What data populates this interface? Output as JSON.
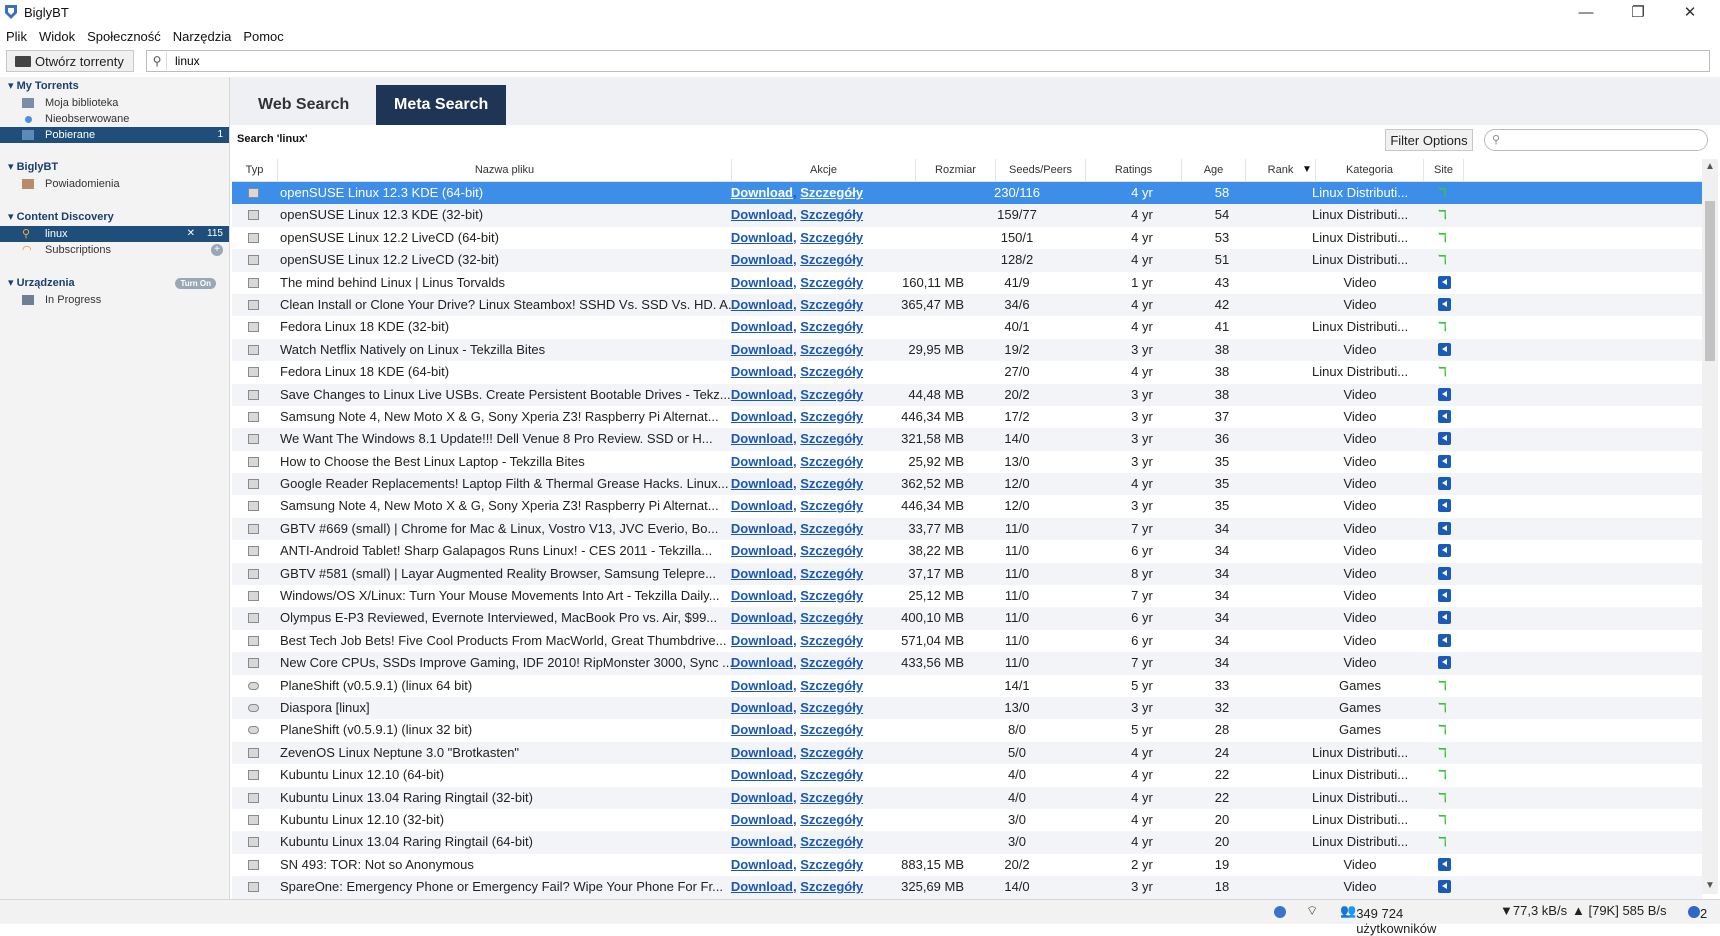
{
  "window": {
    "title": "BiglyBT"
  },
  "menu": [
    "Plik",
    "Widok",
    "Społeczność",
    "Narzędzia",
    "Pomoc"
  ],
  "toolbar": {
    "open_label": "Otwórz torrenty",
    "search_value": "linux"
  },
  "sidebar": {
    "groups": [
      {
        "title": "My Torrents",
        "items": [
          {
            "label": "Moja biblioteka"
          },
          {
            "label": "Nieobserwowane"
          },
          {
            "label": "Pobierane",
            "badge": "1"
          }
        ]
      },
      {
        "title": "BiglyBT",
        "items": [
          {
            "label": "Powiadomienia"
          }
        ]
      },
      {
        "title": "Content Discovery",
        "items": [
          {
            "label": "linux",
            "badge": "115"
          },
          {
            "label": "Subscriptions"
          }
        ]
      },
      {
        "title": "Urządzenia",
        "action": "Turn On",
        "items": [
          {
            "label": "In Progress"
          }
        ]
      }
    ]
  },
  "tabs": {
    "web": "Web Search",
    "meta": "Meta Search"
  },
  "search_label": "Search 'linux'",
  "filter": {
    "button": "Filter Options",
    "placeholder": ""
  },
  "columns": [
    "Typ",
    "Nazwa pliku",
    "Akcje",
    "Rozmiar",
    "Seeds/Peers",
    "Ratings",
    "Age",
    "Rank",
    "Kategoria",
    "Site"
  ],
  "action_labels": {
    "download": "Download",
    "details": "Szczegóły"
  },
  "rows": [
    {
      "name": "openSUSE Linux 12.3 KDE (64-bit)",
      "size": "",
      "sp": "230/116",
      "age": "4 yr",
      "rank": "58",
      "cat": "Linux Distributi...",
      "site": "T",
      "t": "doc"
    },
    {
      "name": "openSUSE Linux 12.3 KDE (32-bit)",
      "size": "",
      "sp": "159/77",
      "age": "4 yr",
      "rank": "54",
      "cat": "Linux Distributi...",
      "site": "T",
      "t": "doc"
    },
    {
      "name": "openSUSE Linux 12.2 LiveCD (64-bit)",
      "size": "",
      "sp": "150/1",
      "age": "4 yr",
      "rank": "53",
      "cat": "Linux Distributi...",
      "site": "T",
      "t": "doc"
    },
    {
      "name": "openSUSE Linux 12.2 LiveCD (32-bit)",
      "size": "",
      "sp": "128/2",
      "age": "4 yr",
      "rank": "51",
      "cat": "Linux Distributi...",
      "site": "T",
      "t": "doc"
    },
    {
      "name": "The mind behind Linux | Linus Torvalds",
      "size": "160,11 MB",
      "sp": "41/9",
      "age": "1 yr",
      "rank": "43",
      "cat": "Video",
      "site": "V",
      "t": "vid"
    },
    {
      "name": "Clean Install or Clone Your Drive? Linux Steambox! SSHD Vs. SSD Vs. HD. A...",
      "size": "365,47 MB",
      "sp": "34/6",
      "age": "4 yr",
      "rank": "42",
      "cat": "Video",
      "site": "V",
      "t": "vid"
    },
    {
      "name": "Fedora Linux 18 KDE (32-bit)",
      "size": "",
      "sp": "40/1",
      "age": "4 yr",
      "rank": "41",
      "cat": "Linux Distributi...",
      "site": "T",
      "t": "doc"
    },
    {
      "name": "Watch Netflix Natively on Linux - Tekzilla Bites",
      "size": "29,95 MB",
      "sp": "19/2",
      "age": "3 yr",
      "rank": "38",
      "cat": "Video",
      "site": "V",
      "t": "vid"
    },
    {
      "name": "Fedora Linux 18 KDE (64-bit)",
      "size": "",
      "sp": "27/0",
      "age": "4 yr",
      "rank": "38",
      "cat": "Linux Distributi...",
      "site": "T",
      "t": "doc"
    },
    {
      "name": "Save Changes to Linux Live USBs. Create Persistent Bootable Drives - Tekz...",
      "size": "44,48 MB",
      "sp": "20/2",
      "age": "3 yr",
      "rank": "38",
      "cat": "Video",
      "site": "V",
      "t": "vid"
    },
    {
      "name": "Samsung Note 4, New Moto X & G, Sony Xperia Z3! Raspberry Pi Alternat...",
      "size": "446,34 MB",
      "sp": "17/2",
      "age": "3 yr",
      "rank": "37",
      "cat": "Video",
      "site": "V",
      "t": "vid"
    },
    {
      "name": "We Want The Windows 8.1 Update!!! Dell Venue 8 Pro Review. SSD or H...",
      "size": "321,58 MB",
      "sp": "14/0",
      "age": "3 yr",
      "rank": "36",
      "cat": "Video",
      "site": "V",
      "t": "vid"
    },
    {
      "name": "How to Choose the Best Linux Laptop - Tekzilla Bites",
      "size": "25,92 MB",
      "sp": "13/0",
      "age": "3 yr",
      "rank": "35",
      "cat": "Video",
      "site": "V",
      "t": "vid"
    },
    {
      "name": "Google Reader Replacements! Laptop Filth & Thermal Grease Hacks. Linux...",
      "size": "362,52 MB",
      "sp": "12/0",
      "age": "4 yr",
      "rank": "35",
      "cat": "Video",
      "site": "V",
      "t": "vid"
    },
    {
      "name": "Samsung Note 4, New Moto X & G, Sony Xperia Z3! Raspberry Pi Alternat...",
      "size": "446,34 MB",
      "sp": "12/0",
      "age": "3 yr",
      "rank": "35",
      "cat": "Video",
      "site": "V",
      "t": "vid"
    },
    {
      "name": "GBTV #669 (small) | Chrome for Mac & Linux, Vostro V13, JVC Everio, Bo...",
      "size": "33,77 MB",
      "sp": "11/0",
      "age": "7 yr",
      "rank": "34",
      "cat": "Video",
      "site": "V",
      "t": "vid"
    },
    {
      "name": "ANTI-Android Tablet! Sharp Galapagos Runs Linux! - CES 2011 - Tekzilla...",
      "size": "38,22 MB",
      "sp": "11/0",
      "age": "6 yr",
      "rank": "34",
      "cat": "Video",
      "site": "V",
      "t": "vid"
    },
    {
      "name": "GBTV #581 (small) | Layar Augmented Reality Browser, Samsung Telepre...",
      "size": "37,17 MB",
      "sp": "11/0",
      "age": "8 yr",
      "rank": "34",
      "cat": "Video",
      "site": "V",
      "t": "vid"
    },
    {
      "name": "Windows/OS X/Linux: Turn Your Mouse Movements Into Art - Tekzilla Daily...",
      "size": "25,12 MB",
      "sp": "11/0",
      "age": "7 yr",
      "rank": "34",
      "cat": "Video",
      "site": "V",
      "t": "vid"
    },
    {
      "name": "Olympus E-P3 Reviewed, Evernote Interviewed, MacBook Pro vs. Air, $99...",
      "size": "400,10 MB",
      "sp": "11/0",
      "age": "6 yr",
      "rank": "34",
      "cat": "Video",
      "site": "V",
      "t": "vid"
    },
    {
      "name": "Best Tech Job Bets! Five Cool Products From MacWorld, Great Thumbdrive...",
      "size": "571,04 MB",
      "sp": "11/0",
      "age": "6 yr",
      "rank": "34",
      "cat": "Video",
      "site": "V",
      "t": "vid"
    },
    {
      "name": "New Core CPUs, SSDs Improve Gaming, IDF 2010! RipMonster 3000, Sync ...",
      "size": "433,56 MB",
      "sp": "11/0",
      "age": "7 yr",
      "rank": "34",
      "cat": "Video",
      "site": "V",
      "t": "vid"
    },
    {
      "name": "PlaneShift (v0.5.9.1) (linux 64 bit)",
      "size": "",
      "sp": "14/1",
      "age": "5 yr",
      "rank": "33",
      "cat": "Games",
      "site": "T",
      "t": "game"
    },
    {
      "name": "Diaspora [linux]",
      "size": "",
      "sp": "13/0",
      "age": "3 yr",
      "rank": "32",
      "cat": "Games",
      "site": "T",
      "t": "game"
    },
    {
      "name": "PlaneShift (v0.5.9.1) (linux 32 bit)",
      "size": "",
      "sp": "8/0",
      "age": "5 yr",
      "rank": "28",
      "cat": "Games",
      "site": "T",
      "t": "game"
    },
    {
      "name": "ZevenOS Linux Neptune 3.0 \"Brotkasten\"",
      "size": "",
      "sp": "5/0",
      "age": "4 yr",
      "rank": "24",
      "cat": "Linux Distributi...",
      "site": "T",
      "t": "doc"
    },
    {
      "name": "Kubuntu Linux 12.10 (64-bit)",
      "size": "",
      "sp": "4/0",
      "age": "4 yr",
      "rank": "22",
      "cat": "Linux Distributi...",
      "site": "T",
      "t": "doc"
    },
    {
      "name": "Kubuntu Linux 13.04 Raring Ringtail (32-bit)",
      "size": "",
      "sp": "4/0",
      "age": "4 yr",
      "rank": "22",
      "cat": "Linux Distributi...",
      "site": "T",
      "t": "doc"
    },
    {
      "name": "Kubuntu Linux 12.10 (32-bit)",
      "size": "",
      "sp": "3/0",
      "age": "4 yr",
      "rank": "20",
      "cat": "Linux Distributi...",
      "site": "T",
      "t": "doc"
    },
    {
      "name": "Kubuntu Linux 13.04 Raring Ringtail (64-bit)",
      "size": "",
      "sp": "3/0",
      "age": "4 yr",
      "rank": "20",
      "cat": "Linux Distributi...",
      "site": "T",
      "t": "doc"
    },
    {
      "name": "SN 493: TOR: Not so Anonymous",
      "size": "883,15 MB",
      "sp": "20/2",
      "age": "2 yr",
      "rank": "19",
      "cat": "Video",
      "site": "V",
      "t": "vid"
    },
    {
      "name": "SpareOne: Emergency Phone or Emergency Fail? Wipe Your Phone For Fr...",
      "size": "325,69 MB",
      "sp": "14/0",
      "age": "3 yr",
      "rank": "18",
      "cat": "Video",
      "site": "V",
      "t": "vid"
    }
  ],
  "status": {
    "users": "349 724 użytkowników",
    "down": "▼77,3 kB/s",
    "up": "▲ [79K] 585 B/s",
    "alerts": "2"
  }
}
